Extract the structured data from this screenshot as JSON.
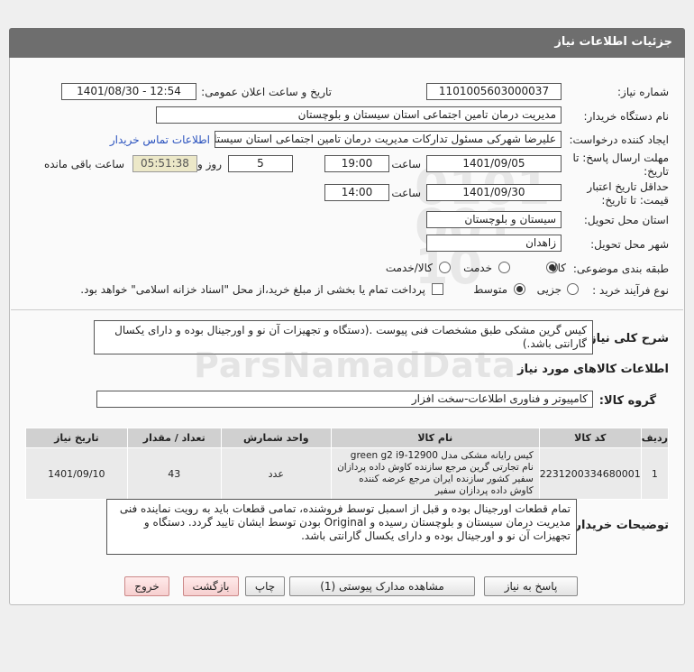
{
  "header": {
    "title": "جزئیات اطلاعات نیاز"
  },
  "fields": {
    "need_number_label": "شماره نیاز:",
    "need_number": "1101005603000037",
    "announce_label": "تاریخ و ساعت اعلان عمومی:",
    "announce_value": "1401/08/30 - 12:54",
    "buyer_org_label": "نام دستگاه خریدار:",
    "buyer_org": "مدیریت درمان تامین اجتماعی استان سیستان و بلوچستان",
    "creator_label": "ایجاد کننده درخواست:",
    "creator": "علیرضا شهرکی مسئول تدارکات مدیریت درمان تامین اجتماعی استان سیستان",
    "contact_link": "اطلاعات تماس خریدار",
    "deadline_label_1": "مهلت ارسال پاسخ: تا",
    "deadline_label_2": "تاریخ:",
    "deadline_date": "1401/09/05",
    "time_label": "ساعت",
    "deadline_time": "19:00",
    "days_value": "5",
    "days_label": "روز و",
    "remaining_time": "05:51:38",
    "remaining_label": "ساعت باقی مانده",
    "validity_label_1": "حداقل تاریخ اعتبار",
    "validity_label_2": "قیمت: تا تاریخ:",
    "validity_date": "1401/09/30",
    "validity_time": "14:00",
    "province_label": "استان محل تحویل:",
    "province": "سیستان و بلوچستان",
    "city_label": "شهر محل تحویل:",
    "city": "زاهدان",
    "category_label": "طبقه بندی موضوعی:",
    "category_options": [
      "کالا",
      "خدمت",
      "کالا/خدمت"
    ],
    "process_label": "نوع فرآیند خرید :",
    "process_options": [
      "جزیی",
      "متوسط"
    ],
    "payment_note": "پرداخت تمام یا بخشی از مبلغ خرید،از محل \"اسناد خزانه اسلامی\" خواهد بود."
  },
  "description": {
    "label": "شرح کلی نیاز:",
    "text": "کیس گرین مشکی طبق مشخصات فنی پیوست  .(دستگاه و تجهیزات آن نو و اورجینال بوده و دارای یکسال گارانتی باشد.)"
  },
  "goods": {
    "section_title": "اطلاعات کالاهای مورد نیاز",
    "group_label": "گروه کالا:",
    "group_value": "کامپیوتر و فناوری اطلاعات-سخت افزار",
    "columns": [
      "ردیف",
      "کد کالا",
      "نام کالا",
      "واحد شمارش",
      "تعداد / مقدار",
      "تاریخ نیاز"
    ],
    "rows": [
      {
        "row": "1",
        "code": "2231200334680001",
        "name": "کیس رایانه مشکی مدل green g2 i9-12900 نام تجارتی گرین مرجع سازنده کاوش داده پردازان سفیر کشور سازنده ایران مرجع عرضه کننده کاوش داده پردازان سفیر",
        "unit": "عدد",
        "qty": "43",
        "date": "1401/09/10"
      }
    ]
  },
  "buyer_notes": {
    "label": "توضیحات خریدار:",
    "text": "تمام قطعات اورجینال بوده و قبل از اسمبل توسط فروشنده، تمامی قطعات باید به رویت نماینده فنی مدیریت درمان سیستان و بلوچستان رسیده و  Original بودن توسط ایشان تایید گردد. دستگاه و تجهیزات آن نو و اورجینال بوده و دارای یکسال گارانتی باشد."
  },
  "buttons": {
    "reply": "پاسخ به نیاز",
    "attachments": "مشاهده مدارک پیوستی (1)",
    "print": "چاپ",
    "back": "بازگشت",
    "exit": "خروج"
  },
  "watermark": {
    "text": "ParsNamadData"
  }
}
